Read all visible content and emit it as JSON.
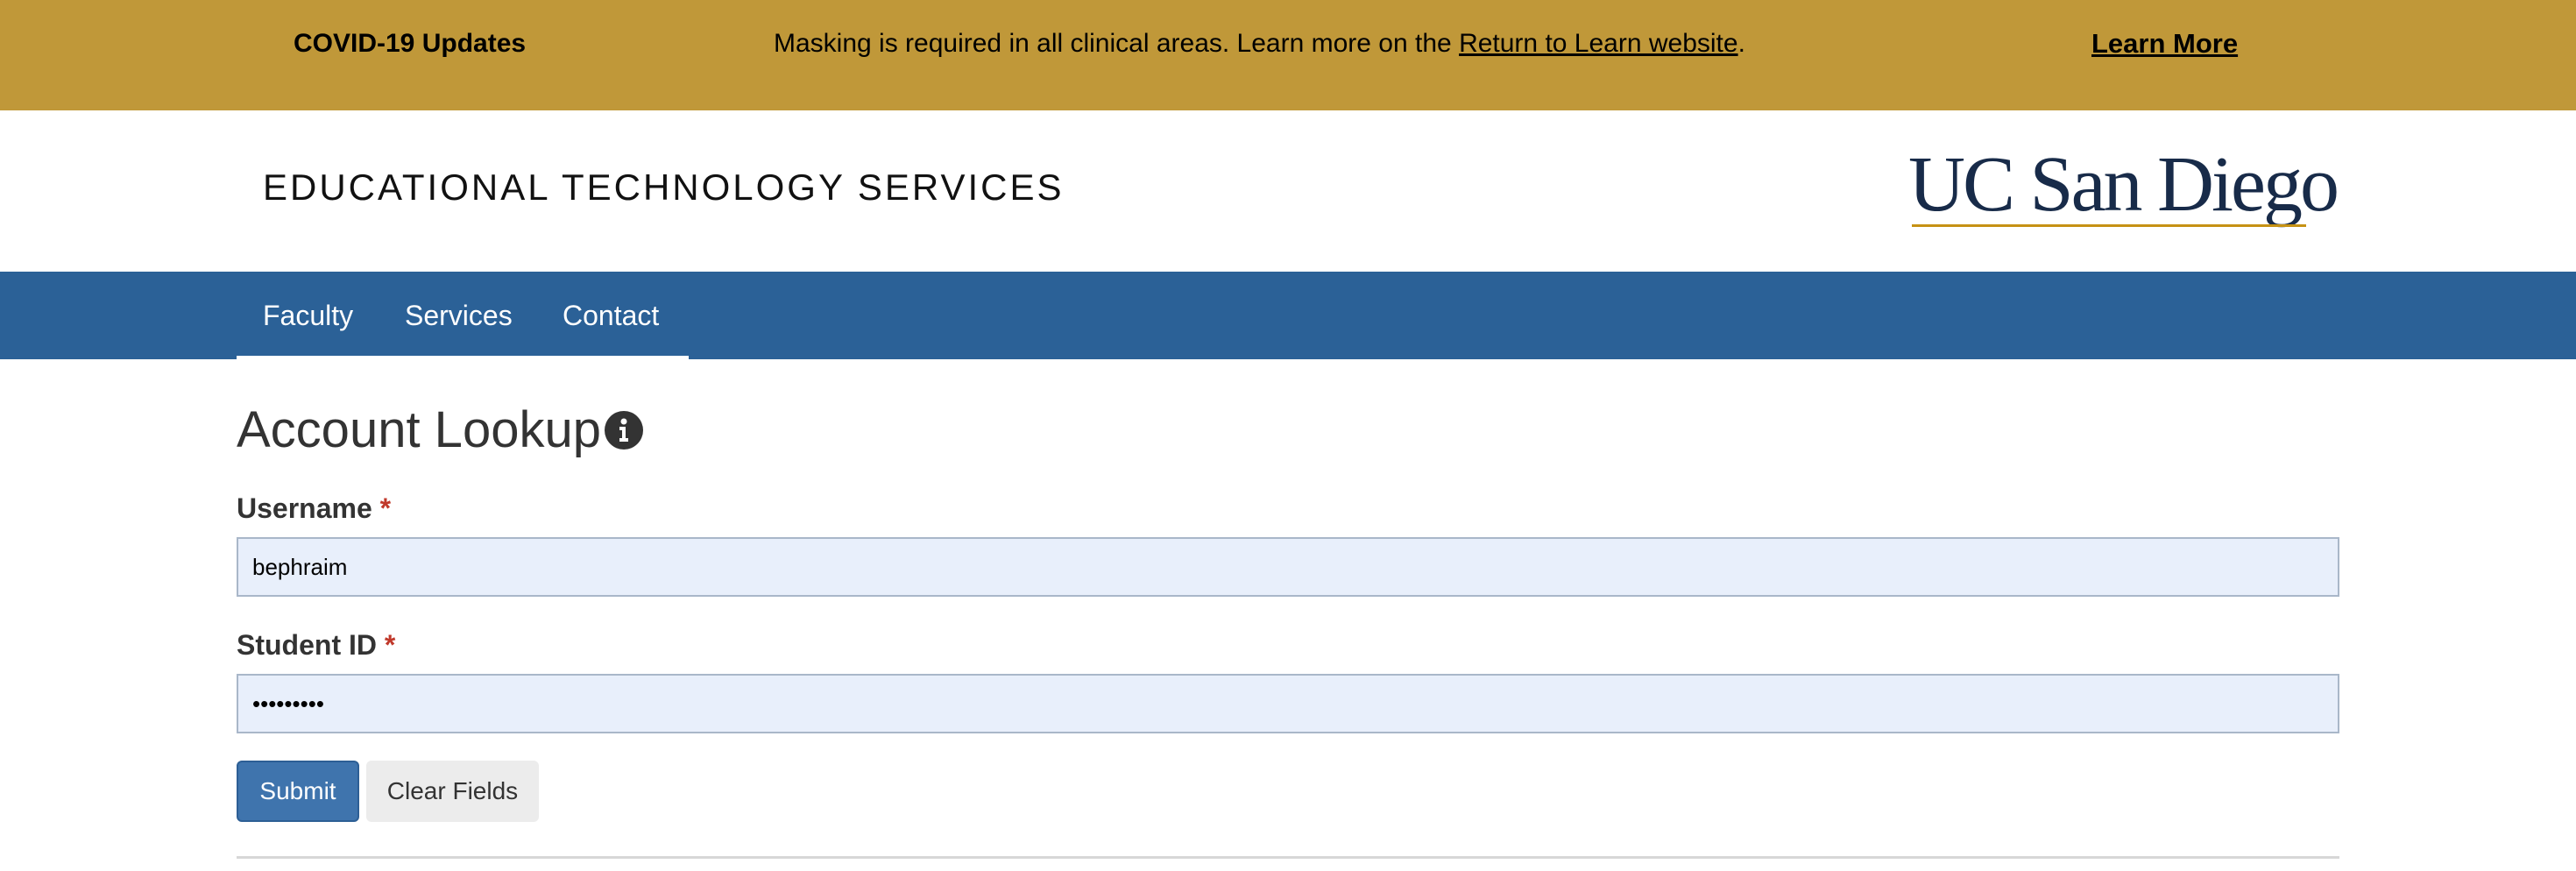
{
  "banner": {
    "title": "COVID-19 Updates",
    "message_prefix": "Masking is required in all clinical areas. Learn more on the ",
    "message_link": "Return to Learn website",
    "message_suffix": ".",
    "cta": "Learn More"
  },
  "header": {
    "site_title": "EDUCATIONAL TECHNOLOGY SERVICES",
    "logo_text": "UC San Diego"
  },
  "nav": {
    "items": [
      {
        "label": "Faculty"
      },
      {
        "label": "Services"
      },
      {
        "label": "Contact"
      }
    ]
  },
  "main": {
    "title": "Account Lookup",
    "info_icon": "info-circle-icon",
    "fields": {
      "username": {
        "label": "Username",
        "required_mark": "*",
        "value": "bephraim"
      },
      "student_id": {
        "label": "Student ID",
        "required_mark": "*",
        "value": "•••••••••"
      }
    },
    "buttons": {
      "submit": "Submit",
      "clear": "Clear Fields"
    }
  },
  "colors": {
    "banner_bg": "#c09839",
    "nav_bg": "#2b6197",
    "logo_navy": "#182b49",
    "logo_gold": "#c69214",
    "input_bg": "#e8effb",
    "submit_bg": "#3f74ad",
    "required": "#c0392b"
  }
}
